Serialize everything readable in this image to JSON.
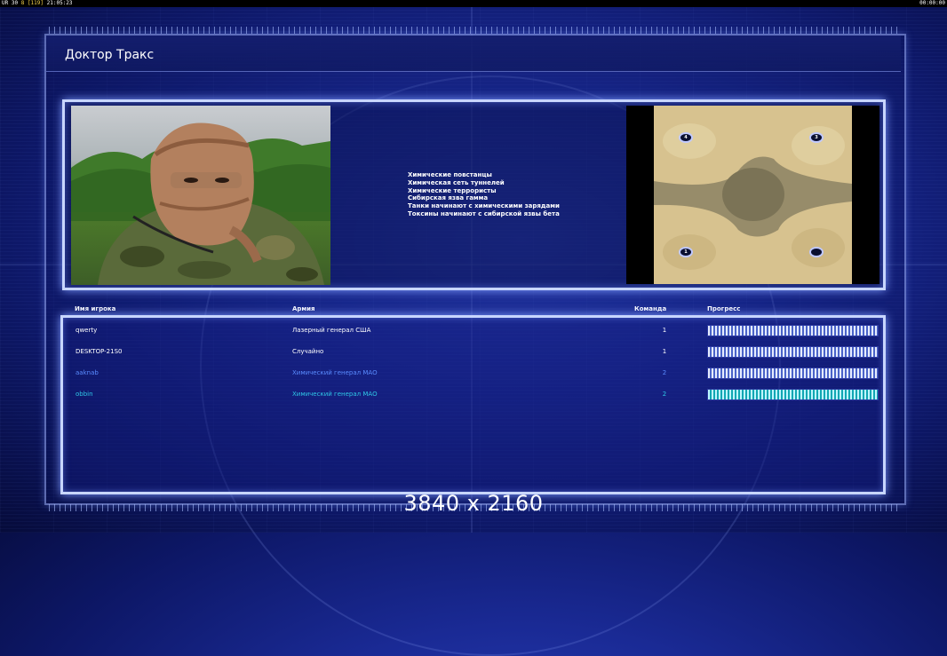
{
  "topbar": {
    "prefix": "UR 30",
    "value": "8",
    "bracket": "[119]",
    "time": "21:05:23",
    "right_time": "00:00:00"
  },
  "title": "Доктор Тракс",
  "briefing_lines": [
    "Химические повстанцы",
    "Химическая сеть туннелей",
    "Химические террористы",
    "Сибирская язва гамма",
    "Танки начинают с химическими зарядами",
    "Токсины начинают с сибирской язвы бета"
  ],
  "start_positions": [
    "4",
    "3",
    "1",
    ""
  ],
  "columns": {
    "player": "Имя игрока",
    "army": "Армия",
    "team": "Команда",
    "progress": "Прогресс"
  },
  "players": [
    {
      "name": "qwerty",
      "army": "Лазерный генерал США",
      "team": "1",
      "progress": 1.0,
      "color": "#ffffff"
    },
    {
      "name": "DESKTOP-21S0",
      "army": "Случайно",
      "team": "1",
      "progress": 1.0,
      "color": "#ffffff"
    },
    {
      "name": "aaknab",
      "army": "Химический генерал МАО",
      "team": "2",
      "progress": 1.0,
      "color": "#5a8cff"
    },
    {
      "name": "obbin",
      "army": "Химический генерал МАО",
      "team": "2",
      "progress": 1.0,
      "color": "#2fc7e6"
    }
  ],
  "resolution_label": "3840 x 2160"
}
